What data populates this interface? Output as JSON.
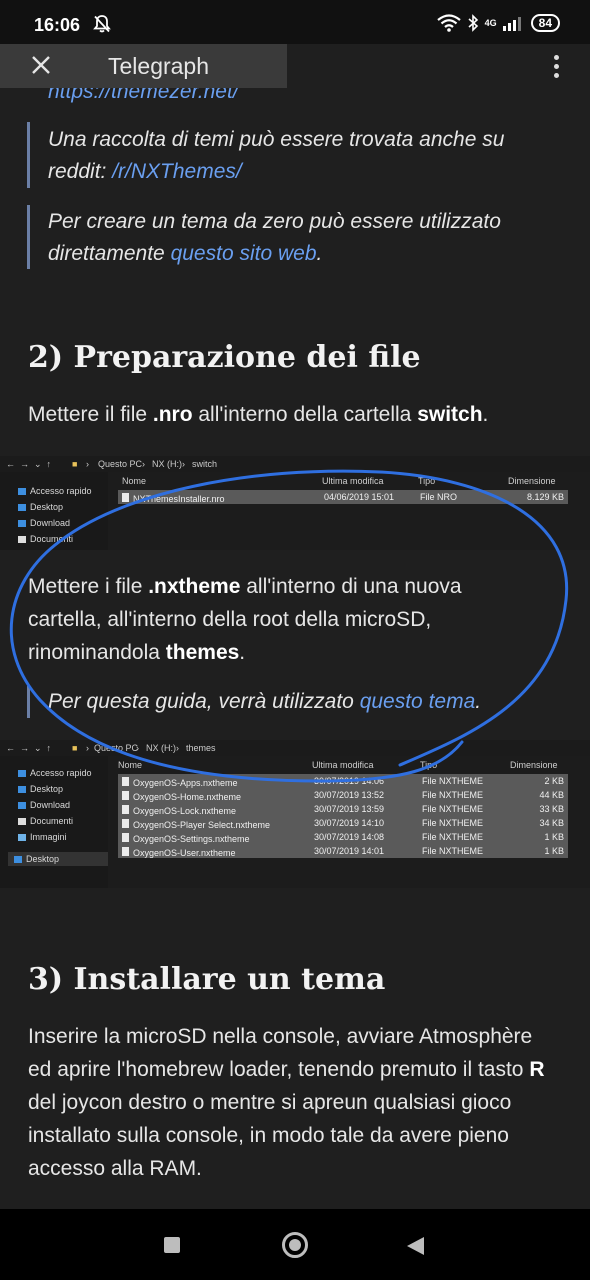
{
  "status_bar": {
    "time": "16:06",
    "network": "4G",
    "battery": "84"
  },
  "app_bar": {
    "title": "Telegraph"
  },
  "article": {
    "url_line": "https://themezer.net/",
    "quote1": {
      "text": "Una raccolta di temi può essere trovata anche su reddit:",
      "link": "/r/NXThemes/"
    },
    "quote2": {
      "text": "Per creare un tema da zero può essere utilizzato direttamente",
      "link": "questo sito web",
      "end": "."
    },
    "section2_heading": "2) Preparazione dei file",
    "p1": {
      "before": "Mettere il file ",
      "bold1": ".nro",
      "middle": " all'interno della cartella ",
      "bold2": "switch",
      "end": "."
    },
    "p2": {
      "before": "Mettere i file ",
      "bold1": ".nxtheme",
      "middle": " all'interno di una nuova cartella, all'interno della root della microSD, rinominandola ",
      "bold2": "themes",
      "end": "."
    },
    "quote3": {
      "text": "Per questa guida, verrà utilizzato",
      "link": "questo tema",
      "end": "."
    },
    "section3_heading": "3) Installare un tema",
    "p3": {
      "before": "Inserire la microSD nella console, avviare Atmosphère ed aprire l'homebrew loader, tenendo premuto il tasto ",
      "bold1": "R",
      "after": " del joycon destro o mentre si apreun qualsiasi gioco installato sulla console, in modo tale da avere pieno accesso alla RAM."
    }
  },
  "explorer1": {
    "breadcrumb": [
      "Questo PC",
      "NX (H:)",
      "switch"
    ],
    "sidebar": [
      "Accesso rapido",
      "Desktop",
      "Download",
      "Documenti"
    ],
    "columns": [
      "Nome",
      "Ultima modifica",
      "Tipo",
      "Dimensione"
    ],
    "rows": [
      {
        "name": "NXThemesInstaller.nro",
        "date": "04/06/2019 15:01",
        "type": "File NRO",
        "size": "8.129 KB"
      }
    ]
  },
  "explorer2": {
    "breadcrumb": [
      "Questo PC",
      "NX (H:)",
      "themes"
    ],
    "sidebar": [
      "Accesso rapido",
      "Desktop",
      "Download",
      "Documenti",
      "Immagini",
      "Desktop"
    ],
    "columns": [
      "Nome",
      "Ultima modifica",
      "Tipo",
      "Dimensione"
    ],
    "rows": [
      {
        "name": "OxygenOS-Apps.nxtheme",
        "date": "30/07/2019 14:06",
        "type": "File NXTHEME",
        "size": "2 KB"
      },
      {
        "name": "OxygenOS-Home.nxtheme",
        "date": "30/07/2019 13:52",
        "type": "File NXTHEME",
        "size": "44 KB"
      },
      {
        "name": "OxygenOS-Lock.nxtheme",
        "date": "30/07/2019 13:59",
        "type": "File NXTHEME",
        "size": "33 KB"
      },
      {
        "name": "OxygenOS-Player Select.nxtheme",
        "date": "30/07/2019 14:10",
        "type": "File NXTHEME",
        "size": "34 KB"
      },
      {
        "name": "OxygenOS-Settings.nxtheme",
        "date": "30/07/2019 14:08",
        "type": "File NXTHEME",
        "size": "1 KB"
      },
      {
        "name": "OxygenOS-User.nxtheme",
        "date": "30/07/2019 14:01",
        "type": "File NXTHEME",
        "size": "1 KB"
      }
    ]
  },
  "nav_bar": {
    "buttons": [
      "recents-icon",
      "home-icon",
      "back-icon"
    ]
  },
  "colors": {
    "link": "#6a9ff0",
    "scribble": "#2f6fe0",
    "background": "#1f1f1f"
  }
}
